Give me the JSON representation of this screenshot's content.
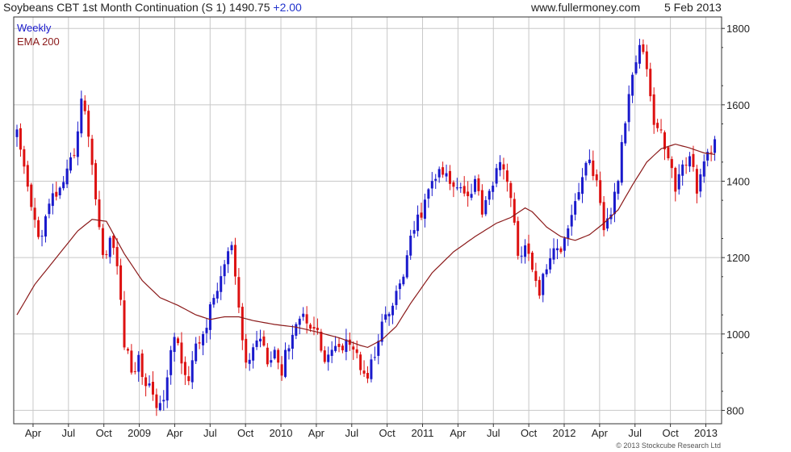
{
  "header": {
    "title": "Soybeans CBT 1st Month Continuation (S 1) 1490.75",
    "change": "+2.00",
    "site": "www.fullermoney.com",
    "date": "5 Feb 2013"
  },
  "copyright": "© 2013 Stockcube Research Ltd",
  "colors": {
    "up": "#1a1acc",
    "down": "#dd1111",
    "ema": "#8b1a1a",
    "grid": "#c8c8c8",
    "axis": "#333333"
  },
  "chart_data": {
    "type": "candlestick",
    "frequency": "Weekly",
    "ylim": [
      765,
      1830
    ],
    "grid": true,
    "yticks": [
      800,
      1000,
      1200,
      1400,
      1600,
      1800
    ],
    "xticks": [
      "Apr",
      "Jul",
      "Oct",
      "2009",
      "Apr",
      "Jul",
      "Oct",
      "2010",
      "Apr",
      "Jul",
      "Oct",
      "2011",
      "Apr",
      "Jul",
      "Oct",
      "2012",
      "Apr",
      "Jul",
      "Oct",
      "2013"
    ],
    "legend": [
      {
        "label": "Weekly",
        "color": "#1a1acc"
      },
      {
        "label": "EMA 200",
        "color": "#8b1a1a"
      }
    ],
    "close_path": [
      [
        0,
        1520
      ],
      [
        2,
        1420
      ],
      [
        4,
        1330
      ],
      [
        6,
        1250
      ],
      [
        8,
        1300
      ],
      [
        10,
        1360
      ],
      [
        13,
        1380
      ],
      [
        16,
        1480
      ],
      [
        18,
        1610
      ],
      [
        20,
        1530
      ],
      [
        22,
        1360
      ],
      [
        24,
        1200
      ],
      [
        26,
        1250
      ],
      [
        28,
        1180
      ],
      [
        30,
        980
      ],
      [
        32,
        900
      ],
      [
        34,
        930
      ],
      [
        36,
        870
      ],
      [
        38,
        850
      ],
      [
        40,
        800
      ],
      [
        42,
        880
      ],
      [
        44,
        1000
      ],
      [
        46,
        940
      ],
      [
        48,
        880
      ],
      [
        50,
        960
      ],
      [
        52,
        1000
      ],
      [
        54,
        1060
      ],
      [
        56,
        1120
      ],
      [
        58,
        1180
      ],
      [
        60,
        1230
      ],
      [
        62,
        1050
      ],
      [
        64,
        920
      ],
      [
        66,
        960
      ],
      [
        68,
        1000
      ],
      [
        70,
        940
      ],
      [
        72,
        960
      ],
      [
        74,
        900
      ],
      [
        76,
        980
      ],
      [
        78,
        1030
      ],
      [
        80,
        1050
      ],
      [
        82,
        1030
      ],
      [
        84,
        1000
      ],
      [
        86,
        930
      ],
      [
        88,
        960
      ],
      [
        90,
        950
      ],
      [
        92,
        1000
      ],
      [
        94,
        960
      ],
      [
        96,
        920
      ],
      [
        98,
        900
      ],
      [
        100,
        940
      ],
      [
        102,
        1020
      ],
      [
        104,
        1050
      ],
      [
        106,
        1100
      ],
      [
        108,
        1160
      ],
      [
        110,
        1240
      ],
      [
        112,
        1300
      ],
      [
        114,
        1340
      ],
      [
        116,
        1400
      ],
      [
        118,
        1420
      ],
      [
        120,
        1410
      ],
      [
        122,
        1380
      ],
      [
        124,
        1400
      ],
      [
        126,
        1360
      ],
      [
        128,
        1400
      ],
      [
        130,
        1330
      ],
      [
        132,
        1380
      ],
      [
        134,
        1420
      ],
      [
        136,
        1450
      ],
      [
        138,
        1350
      ],
      [
        140,
        1200
      ],
      [
        142,
        1240
      ],
      [
        144,
        1160
      ],
      [
        146,
        1110
      ],
      [
        148,
        1180
      ],
      [
        150,
        1210
      ],
      [
        152,
        1230
      ],
      [
        154,
        1290
      ],
      [
        156,
        1350
      ],
      [
        158,
        1410
      ],
      [
        160,
        1460
      ],
      [
        162,
        1390
      ],
      [
        164,
        1260
      ],
      [
        166,
        1320
      ],
      [
        168,
        1410
      ],
      [
        170,
        1560
      ],
      [
        172,
        1690
      ],
      [
        174,
        1770
      ],
      [
        176,
        1700
      ],
      [
        178,
        1550
      ],
      [
        180,
        1520
      ],
      [
        182,
        1470
      ],
      [
        184,
        1380
      ],
      [
        186,
        1440
      ],
      [
        188,
        1470
      ],
      [
        190,
        1380
      ],
      [
        192,
        1440
      ],
      [
        194,
        1491
      ]
    ],
    "ema_path": [
      [
        0,
        1050
      ],
      [
        5,
        1130
      ],
      [
        11,
        1200
      ],
      [
        17,
        1270
      ],
      [
        21,
        1300
      ],
      [
        25,
        1295
      ],
      [
        30,
        1210
      ],
      [
        35,
        1140
      ],
      [
        40,
        1095
      ],
      [
        45,
        1075
      ],
      [
        50,
        1050
      ],
      [
        54,
        1038
      ],
      [
        58,
        1045
      ],
      [
        62,
        1045
      ],
      [
        66,
        1035
      ],
      [
        72,
        1025
      ],
      [
        78,
        1018
      ],
      [
        84,
        1005
      ],
      [
        90,
        990
      ],
      [
        96,
        970
      ],
      [
        98,
        965
      ],
      [
        102,
        985
      ],
      [
        106,
        1020
      ],
      [
        110,
        1080
      ],
      [
        116,
        1160
      ],
      [
        122,
        1215
      ],
      [
        128,
        1255
      ],
      [
        134,
        1290
      ],
      [
        138,
        1305
      ],
      [
        142,
        1330
      ],
      [
        144,
        1320
      ],
      [
        148,
        1280
      ],
      [
        152,
        1255
      ],
      [
        156,
        1245
      ],
      [
        160,
        1260
      ],
      [
        164,
        1290
      ],
      [
        168,
        1325
      ],
      [
        172,
        1390
      ],
      [
        176,
        1450
      ],
      [
        180,
        1485
      ],
      [
        184,
        1497
      ],
      [
        188,
        1487
      ],
      [
        192,
        1474
      ],
      [
        195,
        1470
      ]
    ]
  }
}
